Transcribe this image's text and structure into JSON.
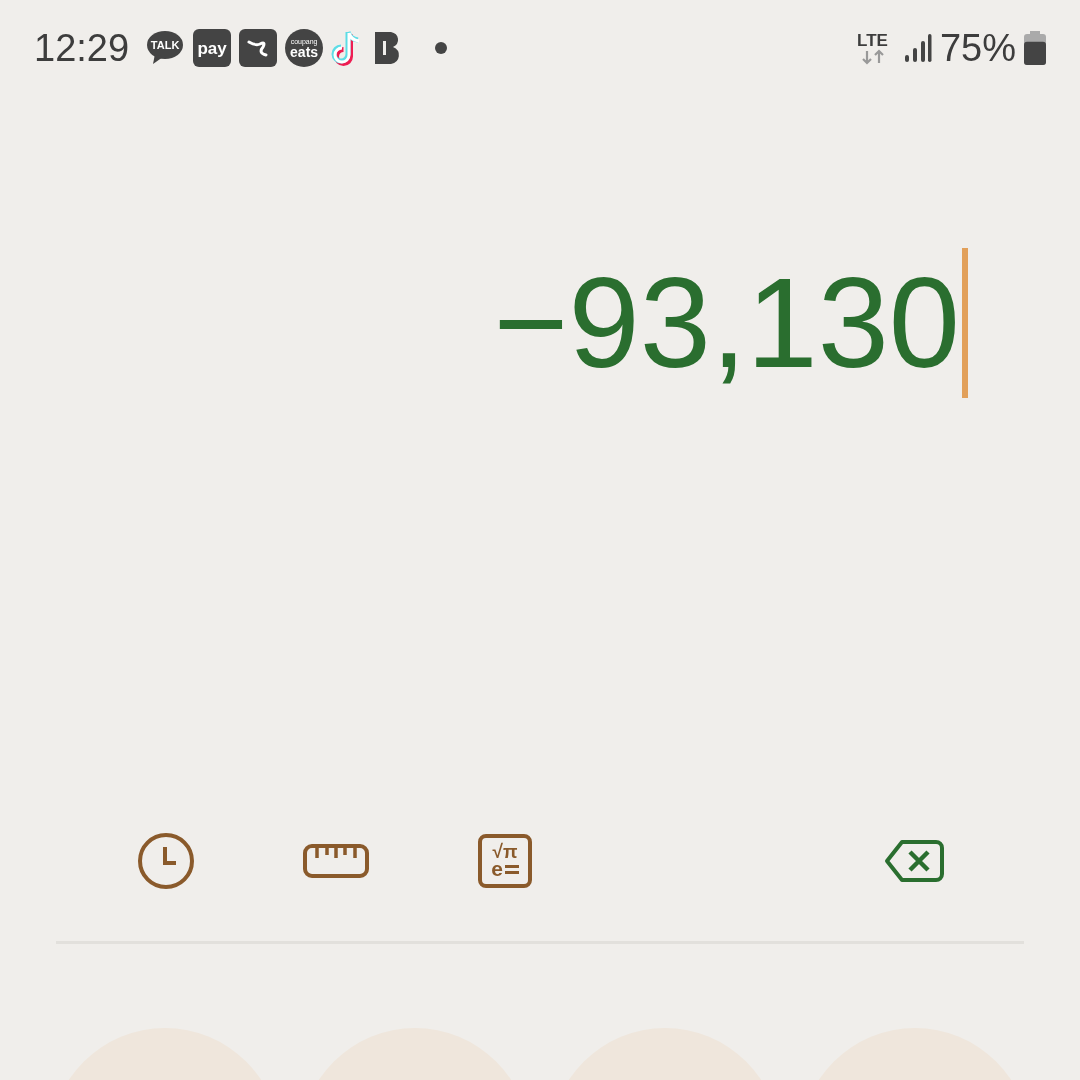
{
  "status_bar": {
    "time": "12:29",
    "notifications": [
      {
        "kind": "talk",
        "label": "TALK"
      },
      {
        "kind": "pay",
        "label": "pay"
      },
      {
        "kind": "e-logo"
      },
      {
        "kind": "eats",
        "label": "eats",
        "sublabel": "coupang"
      },
      {
        "kind": "note"
      },
      {
        "kind": "b-logo"
      },
      {
        "kind": "dot"
      }
    ],
    "network": "LTE",
    "battery": "75%"
  },
  "display": {
    "value": "−93,130",
    "cursor": true
  },
  "toolbar": [
    {
      "kind": "history"
    },
    {
      "kind": "converter"
    },
    {
      "kind": "scientific",
      "labels": [
        "√π",
        "e"
      ]
    },
    {
      "kind": "backspace"
    }
  ],
  "keypad": [
    {
      "kind": "key"
    },
    {
      "kind": "key"
    },
    {
      "kind": "key"
    },
    {
      "kind": "key"
    }
  ]
}
